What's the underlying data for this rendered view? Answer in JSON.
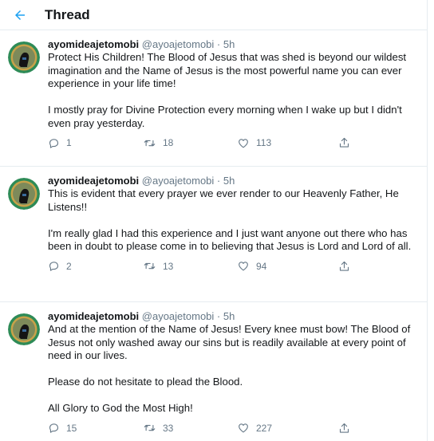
{
  "header": {
    "title": "Thread"
  },
  "tweets": [
    {
      "name": "ayomideajetomobi",
      "handle": "@ayoajetomobi",
      "time": "5h",
      "paragraphs": [
        "Protect His Children! The Blood of Jesus that was shed is beyond our wildest imagination and the Name of Jesus is the most powerful name you can ever experience in your life time!",
        "I mostly pray for Divine Protection every morning when I wake up but I didn't even pray yesterday."
      ],
      "replies": "1",
      "retweets": "18",
      "likes": "113"
    },
    {
      "name": "ayomideajetomobi",
      "handle": "@ayoajetomobi",
      "time": "5h",
      "paragraphs": [
        "This is evident that every prayer we ever render to our Heavenly Father, He Listens!!",
        "I'm really glad I had this experience and I just want anyone out there who has been in doubt to please come in to believing that Jesus is Lord and Lord of all."
      ],
      "replies": "2",
      "retweets": "13",
      "likes": "94"
    },
    {
      "name": "ayomideajetomobi",
      "handle": "@ayoajetomobi",
      "time": "5h",
      "paragraphs": [
        "And at the mention of the Name of Jesus! Every knee must bow! The Blood of Jesus not only washed away our sins but is readily available at every point of need in our lives.",
        "Please do not hesitate to plead the Blood.",
        "All Glory to God the Most High!"
      ],
      "replies": "15",
      "retweets": "33",
      "likes": "227"
    }
  ],
  "colors": {
    "accent": "#1da1f2",
    "secondary_text": "#657786",
    "border": "#e6ecf0",
    "avatar_ring": "#2e8b57"
  },
  "icons": {
    "back": "back-arrow-icon",
    "reply": "reply-icon",
    "retweet": "retweet-icon",
    "like": "heart-icon",
    "share": "share-icon"
  }
}
